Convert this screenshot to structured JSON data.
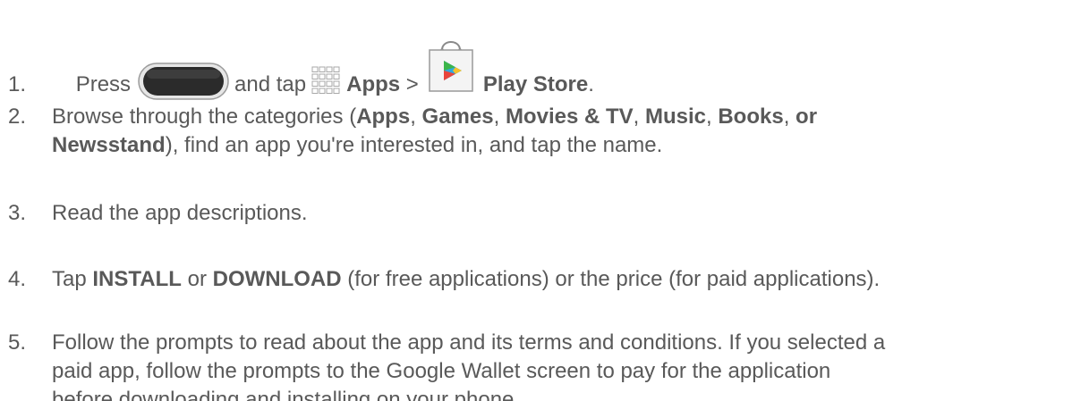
{
  "steps": [
    {
      "number": "1.",
      "t_press": "Press",
      "t_and_tap": "and tap",
      "b_apps": "Apps",
      "t_gt": ">",
      "b_play_store": "Play Store",
      "t_period": ".",
      "icons": [
        "home-key-icon",
        "apps-grid-icon",
        "play-store-icon"
      ]
    },
    {
      "number": "2.",
      "t_browse": "Browse through the categories (",
      "b_apps": "Apps",
      "t_c1": ", ",
      "b_games": "Games",
      "t_c2": ", ",
      "b_movies": "Movies & TV",
      "t_c3": ", ",
      "b_music": "Music",
      "t_c4": ", ",
      "b_books": "Books",
      "t_c5": ", ",
      "b_or": "or",
      "b_newsstand": "Newsstand",
      "t_rest": "), find an app you're interested in, and tap the name."
    },
    {
      "number": "3.",
      "text": "Read the app descriptions."
    },
    {
      "number": "4.",
      "t_tap": "Tap ",
      "b_install": "INSTALL",
      "t_or": " or ",
      "b_download": "DOWNLOAD",
      "t_rest": " (for free applications) or the price (for paid applications)."
    },
    {
      "number": "5.",
      "line1": "Follow the prompts to read about the app and its terms and conditions. If you selected a",
      "line2": "paid app, follow the prompts to the Google Wallet screen to pay for the application",
      "line3": "before downloading and installing on your phone."
    }
  ],
  "colors": {
    "text": "#595959",
    "home_key": "#2b2b2b",
    "grid": "#a8a8a8",
    "play_green": "#3bb54a",
    "play_blue": "#2fa8e0",
    "play_yellow": "#f6c22a",
    "play_red": "#e8453c"
  }
}
